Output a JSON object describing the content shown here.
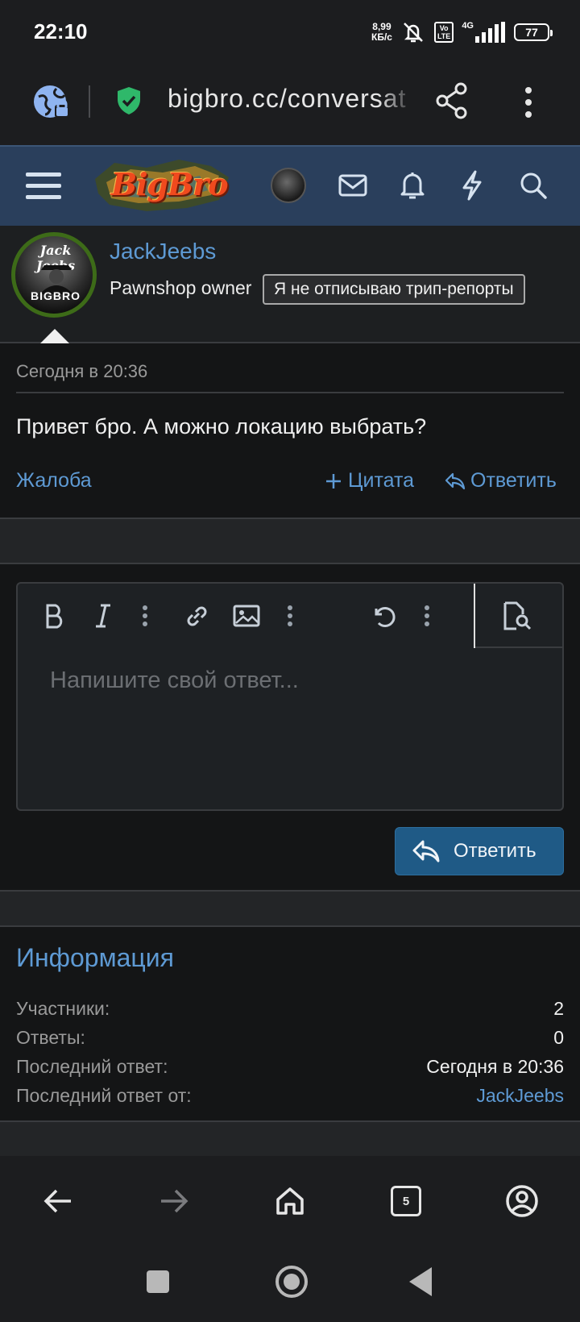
{
  "status_bar": {
    "time": "22:10",
    "net_speed_value": "8,99",
    "net_speed_unit": "КБ/с",
    "volte_top": "Vo",
    "volte_bottom": "LTE",
    "network": "4G",
    "battery": "77"
  },
  "browser": {
    "url": "bigbro.cc/conversat",
    "open_tabs": "5"
  },
  "site": {
    "logo_text": "BigBro"
  },
  "message": {
    "author_name": "JackJeebs",
    "author_title": "Pawnshop owner",
    "author_banner": "Я не отписываю трип-репорты",
    "avatar_text_top": "Jack Jeebs",
    "avatar_text_bottom": "BIGBRO",
    "date": "Сегодня в 20:36",
    "text": "Привет бро. А можно локацию выбрать?",
    "report_label": "Жалоба",
    "quote_label": "Цитата",
    "reply_label": "Ответить"
  },
  "editor": {
    "placeholder": "Напишите свой ответ...",
    "submit_label": "Ответить"
  },
  "info": {
    "title": "Информация",
    "rows": [
      {
        "label": "Участники:",
        "value": "2"
      },
      {
        "label": "Ответы:",
        "value": "0"
      },
      {
        "label": "Последний ответ:",
        "value": "Сегодня в 20:36"
      },
      {
        "label": "Последний ответ от:",
        "value": "JackJeebs"
      }
    ]
  },
  "colors": {
    "link": "#5e9ad4",
    "header_bg": "#2a3f5c",
    "button_bg": "#1f5a86",
    "avatar_ring": "#3d6b18"
  }
}
